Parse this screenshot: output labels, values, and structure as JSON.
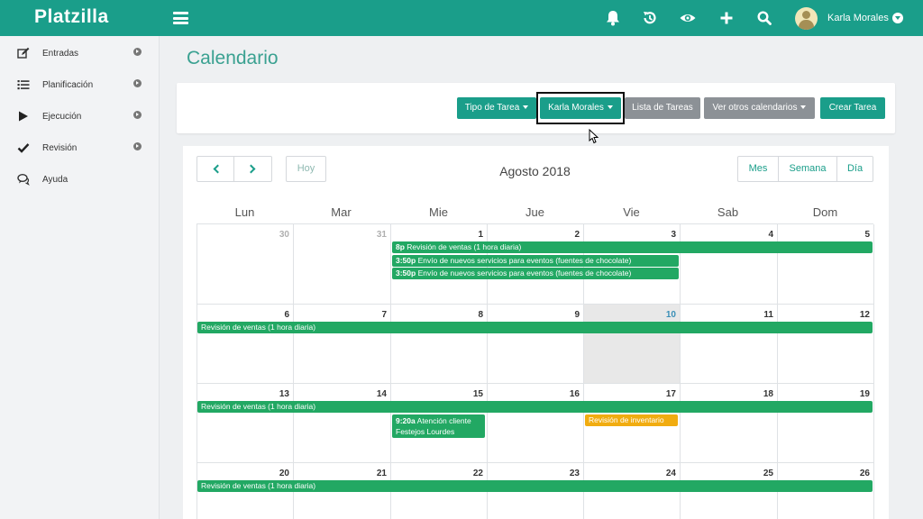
{
  "app": {
    "name": "Platzilla"
  },
  "user": {
    "name": "Karla Morales"
  },
  "sidebar": {
    "items": [
      {
        "label": "Entradas"
      },
      {
        "label": "Planificación"
      },
      {
        "label": "Ejecución"
      },
      {
        "label": "Revisión"
      },
      {
        "label": "Ayuda"
      }
    ]
  },
  "page": {
    "title": "Calendario"
  },
  "toolbar": {
    "tipo_tarea": "Tipo de Tarea",
    "user_filter": "Karla Morales",
    "lista_tareas": "Lista de Tareas",
    "otros_calendarios": "Ver otros calendarios",
    "crear_tarea": "Crear Tarea"
  },
  "calendar": {
    "today_label": "Hoy",
    "title": "Agosto 2018",
    "views": [
      "Mes",
      "Semana",
      "Día"
    ],
    "day_headers": [
      "Lun",
      "Mar",
      "Mie",
      "Jue",
      "Vie",
      "Sab",
      "Dom"
    ],
    "weeks": [
      [
        "30",
        "31",
        "1",
        "2",
        "3",
        "4",
        "5"
      ],
      [
        "6",
        "7",
        "8",
        "9",
        "10",
        "11",
        "12"
      ],
      [
        "13",
        "14",
        "15",
        "16",
        "17",
        "18",
        "19"
      ],
      [
        "20",
        "21",
        "22",
        "23",
        "24",
        "25",
        "26"
      ]
    ],
    "events": {
      "w1_revision": {
        "time": "8p",
        "title": "Revisión de ventas (1 hora diaria)"
      },
      "w1_envio_1": {
        "time": "3:50p",
        "title": "Envío de nuevos servicios para eventos (fuentes de chocolate)"
      },
      "w1_envio_2": {
        "time": "3:50p",
        "title": "Envío de nuevos servicios para eventos (fuentes de chocolate)"
      },
      "w2_revision": {
        "title": "Revisión de ventas (1 hora diaria)"
      },
      "w3_revision": {
        "title": "Revisión de ventas (1 hora diaria)"
      },
      "w3_atencion": {
        "time": "9:20a",
        "title": "Atención cliente",
        "subtitle": "Festejos Lourdes"
      },
      "w3_inventario": {
        "title": "Revisión de inventario"
      },
      "w4_revision": {
        "title": "Revisión de ventas (1 hora diaria)"
      }
    }
  },
  "colors": {
    "brand": "#1a9e8a",
    "event_green": "#22a863",
    "event_yellow": "#f1ac10",
    "today_bg": "#e8e8e8"
  },
  "icons": [
    "menu-icon",
    "bell-icon",
    "history-icon",
    "eye-icon",
    "plus-icon",
    "search-icon",
    "pencil-square-icon",
    "list-icon",
    "play-icon",
    "check-icon",
    "chat-icon"
  ]
}
